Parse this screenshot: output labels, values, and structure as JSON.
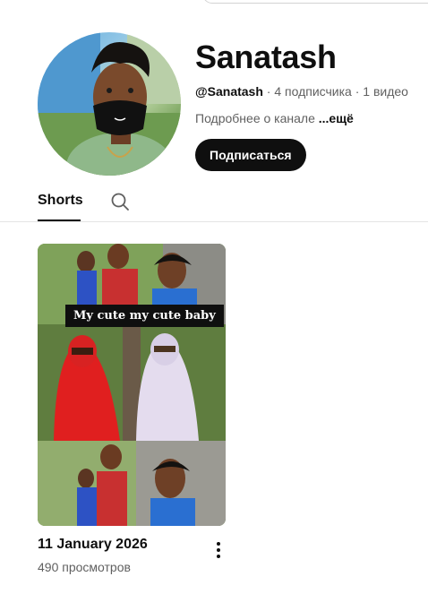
{
  "channel": {
    "name": "Sanatash",
    "handle": "@Sanatash",
    "subscribers": " · 4 подписчика · 1 видео",
    "description": "Подробнее о канале",
    "more_label": "...ещё",
    "subscribe_label": "Подписаться"
  },
  "tabs": {
    "shorts_label": "Shorts",
    "search_icon": "search-icon"
  },
  "shorts": [
    {
      "caption": "My cute my cute baby",
      "title": "11 January 2026",
      "views": "490 просмотров"
    }
  ],
  "colors": {
    "accent": "#0f0f0f",
    "muted_text": "#606060",
    "divider": "#e5e5e5"
  }
}
